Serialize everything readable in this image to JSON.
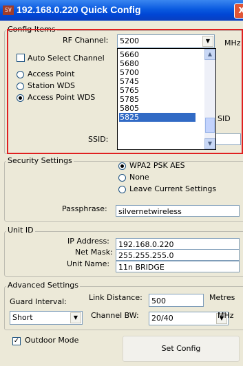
{
  "window": {
    "icon_text": "SV",
    "title": "192.168.0.220 Quick Config",
    "close_label": "X"
  },
  "config_items": {
    "legend": "Config Items",
    "rf_channel_label": "RF Channel:",
    "rf_channel_value": "5200",
    "rf_unit": "MHz",
    "auto_select_label": "Auto Select Channel",
    "auto_select_checked": false,
    "modes": [
      {
        "label": "Access Point",
        "selected": false
      },
      {
        "label": "Station WDS",
        "selected": false
      },
      {
        "label": "Access Point WDS",
        "selected": true
      }
    ],
    "ssid_label": "SSID:",
    "ssid_peek_label": "SID",
    "channel_options": [
      "5660",
      "5680",
      "5700",
      "5745",
      "5765",
      "5785",
      "5805",
      "5825"
    ],
    "channel_selected": "5825"
  },
  "security": {
    "legend": "Security Settings",
    "options": [
      {
        "label": "WPA2 PSK AES",
        "selected": true
      },
      {
        "label": "None",
        "selected": false
      },
      {
        "label": "Leave Current Settings",
        "selected": false
      }
    ],
    "passphrase_label": "Passphrase:",
    "passphrase_value": "silvernetwireless"
  },
  "unit_id": {
    "legend": "Unit ID",
    "ip_label": "IP Address:",
    "ip_value": "192.168.0.220",
    "mask_label": "Net Mask:",
    "mask_value": "255.255.255.0",
    "name_label": "Unit Name:",
    "name_value": "11n BRIDGE"
  },
  "advanced": {
    "legend": "Advanced Settings",
    "link_distance_label": "Link Distance:",
    "link_distance_value": "500",
    "link_distance_unit": "Metres",
    "guard_interval_label": "Guard Interval:",
    "guard_interval_value": "Short",
    "channel_bw_label": "Channel BW:",
    "channel_bw_value": "20/40",
    "channel_bw_unit": "MHz"
  },
  "footer": {
    "outdoor_label": "Outdoor Mode",
    "outdoor_checked": true,
    "set_config_label": "Set Config"
  },
  "colors": {
    "title_bar": "#0a5ae0",
    "highlight_box": "#e02020",
    "list_selection": "#316ac5",
    "dialog_bg": "#ece9d8"
  }
}
